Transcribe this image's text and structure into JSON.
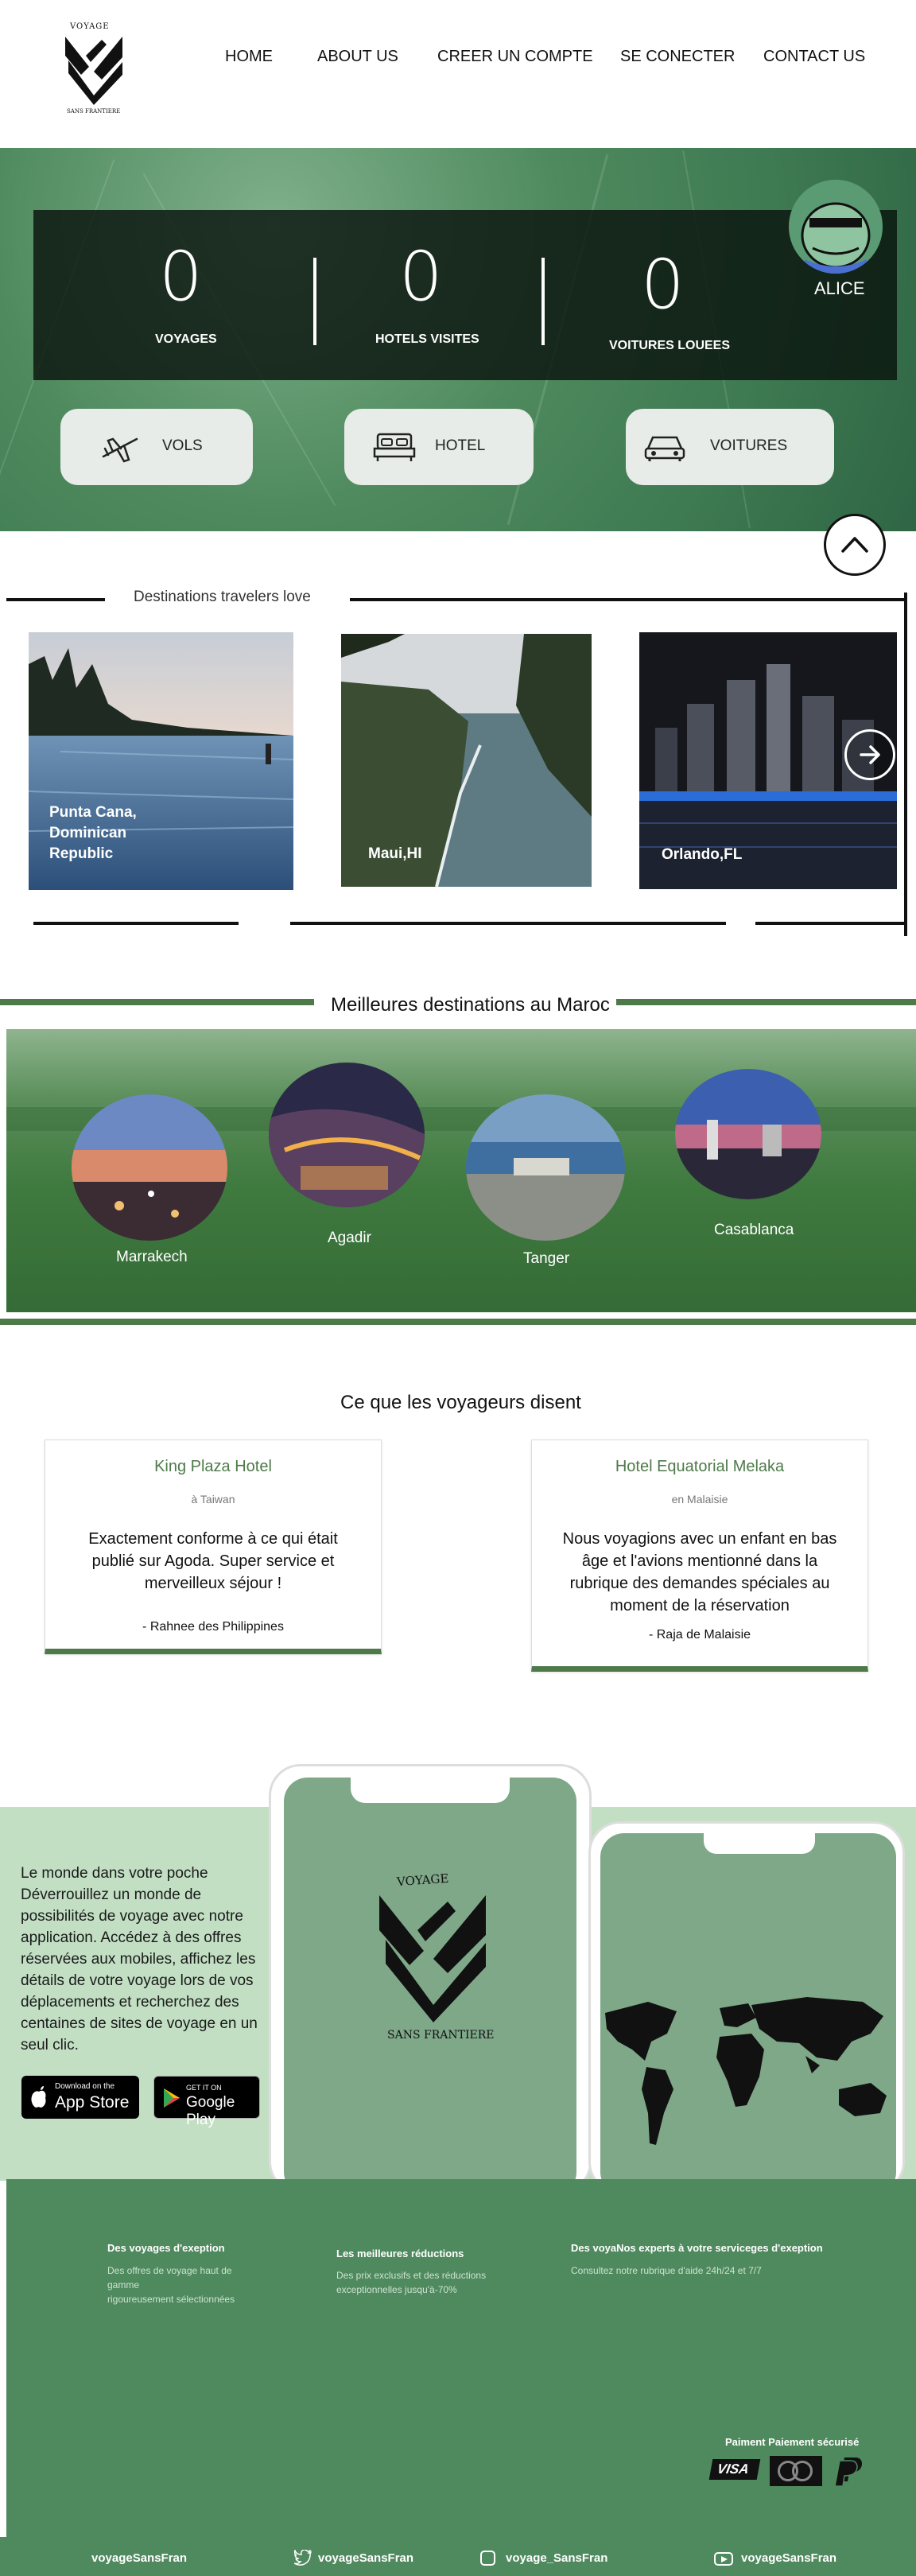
{
  "logo": {
    "top_text": "VOYAGE",
    "bottom_text": "SANS FRANTIERE"
  },
  "nav": [
    "HOME",
    "ABOUT US",
    "CREER UN COMPTE",
    "SE CONECTER",
    "CONTACT US"
  ],
  "stats": [
    {
      "value": "0",
      "label": "VOYAGES"
    },
    {
      "value": "0",
      "label": "HOTELS VISITES"
    },
    {
      "value": "0",
      "label": "VOITURES LOUEES"
    }
  ],
  "user": {
    "name": "ALICE"
  },
  "services": [
    {
      "label": "VOLS",
      "icon": "plane-icon"
    },
    {
      "label": "HOTEL",
      "icon": "bed-icon"
    },
    {
      "label": "VOITURES",
      "icon": "car-icon"
    }
  ],
  "destinations": {
    "title": "Destinations travelers love",
    "cards": [
      {
        "label_lines": [
          "Punta Cana,",
          "Dominican",
          "Republic"
        ]
      },
      {
        "label_lines": [
          "Maui,HI"
        ]
      },
      {
        "label_lines": [
          "Orlando,FL"
        ]
      }
    ]
  },
  "morocco": {
    "title": "Meilleures destinations au Maroc",
    "cities": [
      "Marrakech",
      "Agadir",
      "Tanger",
      "Casablanca"
    ]
  },
  "reviews": {
    "title": "Ce que les voyageurs disent",
    "items": [
      {
        "hotel": "King Plaza Hotel",
        "location": "à Taiwan",
        "lines": [
          "Exactement conforme à ce qui était",
          "publié sur Agoda. Super service et",
          "merveilleux séjour !"
        ],
        "author": "- Rahnee des Philippines"
      },
      {
        "hotel": "Hotel Equatorial Melaka",
        "location": "en Malaisie",
        "lines": [
          "Nous voyagions avec un enfant en bas",
          "âge et l'avions mentionné dans la",
          "rubrique des demandes spéciales au",
          "moment de la réservation"
        ],
        "author": "- Raja de Malaisie"
      }
    ]
  },
  "app": {
    "lines": [
      "Le monde dans votre poche",
      "Déverrouillez un monde de",
      "possibilités de voyage avec notre",
      "application. Accédez à des offres",
      "réservées aux mobiles, affichez les",
      "détails de votre voyage lors de vos",
      "déplacements et recherchez des",
      "centaines de sites de voyage en un",
      "seul clic."
    ],
    "app_store_small": "Download on the",
    "app_store_big": "App Store",
    "play_small": "GET IT ON",
    "play_big": "Google Play",
    "phone_logo_top": "VOYAGE",
    "phone_logo_bottom": "SANS FRANTIERE"
  },
  "footer": {
    "col1_title": "Des voyages d'exeption",
    "col1_lines": [
      "Des offres de voyage haut de",
      "gamme",
      "rigoureusement sélectionnées"
    ],
    "col2_title": "Les meilleures réductions",
    "col2_lines": [
      "Des prix exclusifs et des réductions",
      "exceptionnelles jusqu'à-70%"
    ],
    "col3_title": "Des voyaNos experts à votre serviceges d'exeption",
    "col3_lines": [
      "Consultez notre rubrique d'aide 24h/24 et 7/7"
    ],
    "payment_title": "Paiment Paiement sécurisé",
    "payment_visa": "VISA"
  },
  "social": [
    {
      "label": "voyageSansFran",
      "icon": ""
    },
    {
      "label": "voyageSansFran",
      "icon": "twitter-icon"
    },
    {
      "label": "voyage_SansFran",
      "icon": "instagram-icon"
    },
    {
      "label": "voyageSansFran",
      "icon": "youtube-icon"
    }
  ]
}
